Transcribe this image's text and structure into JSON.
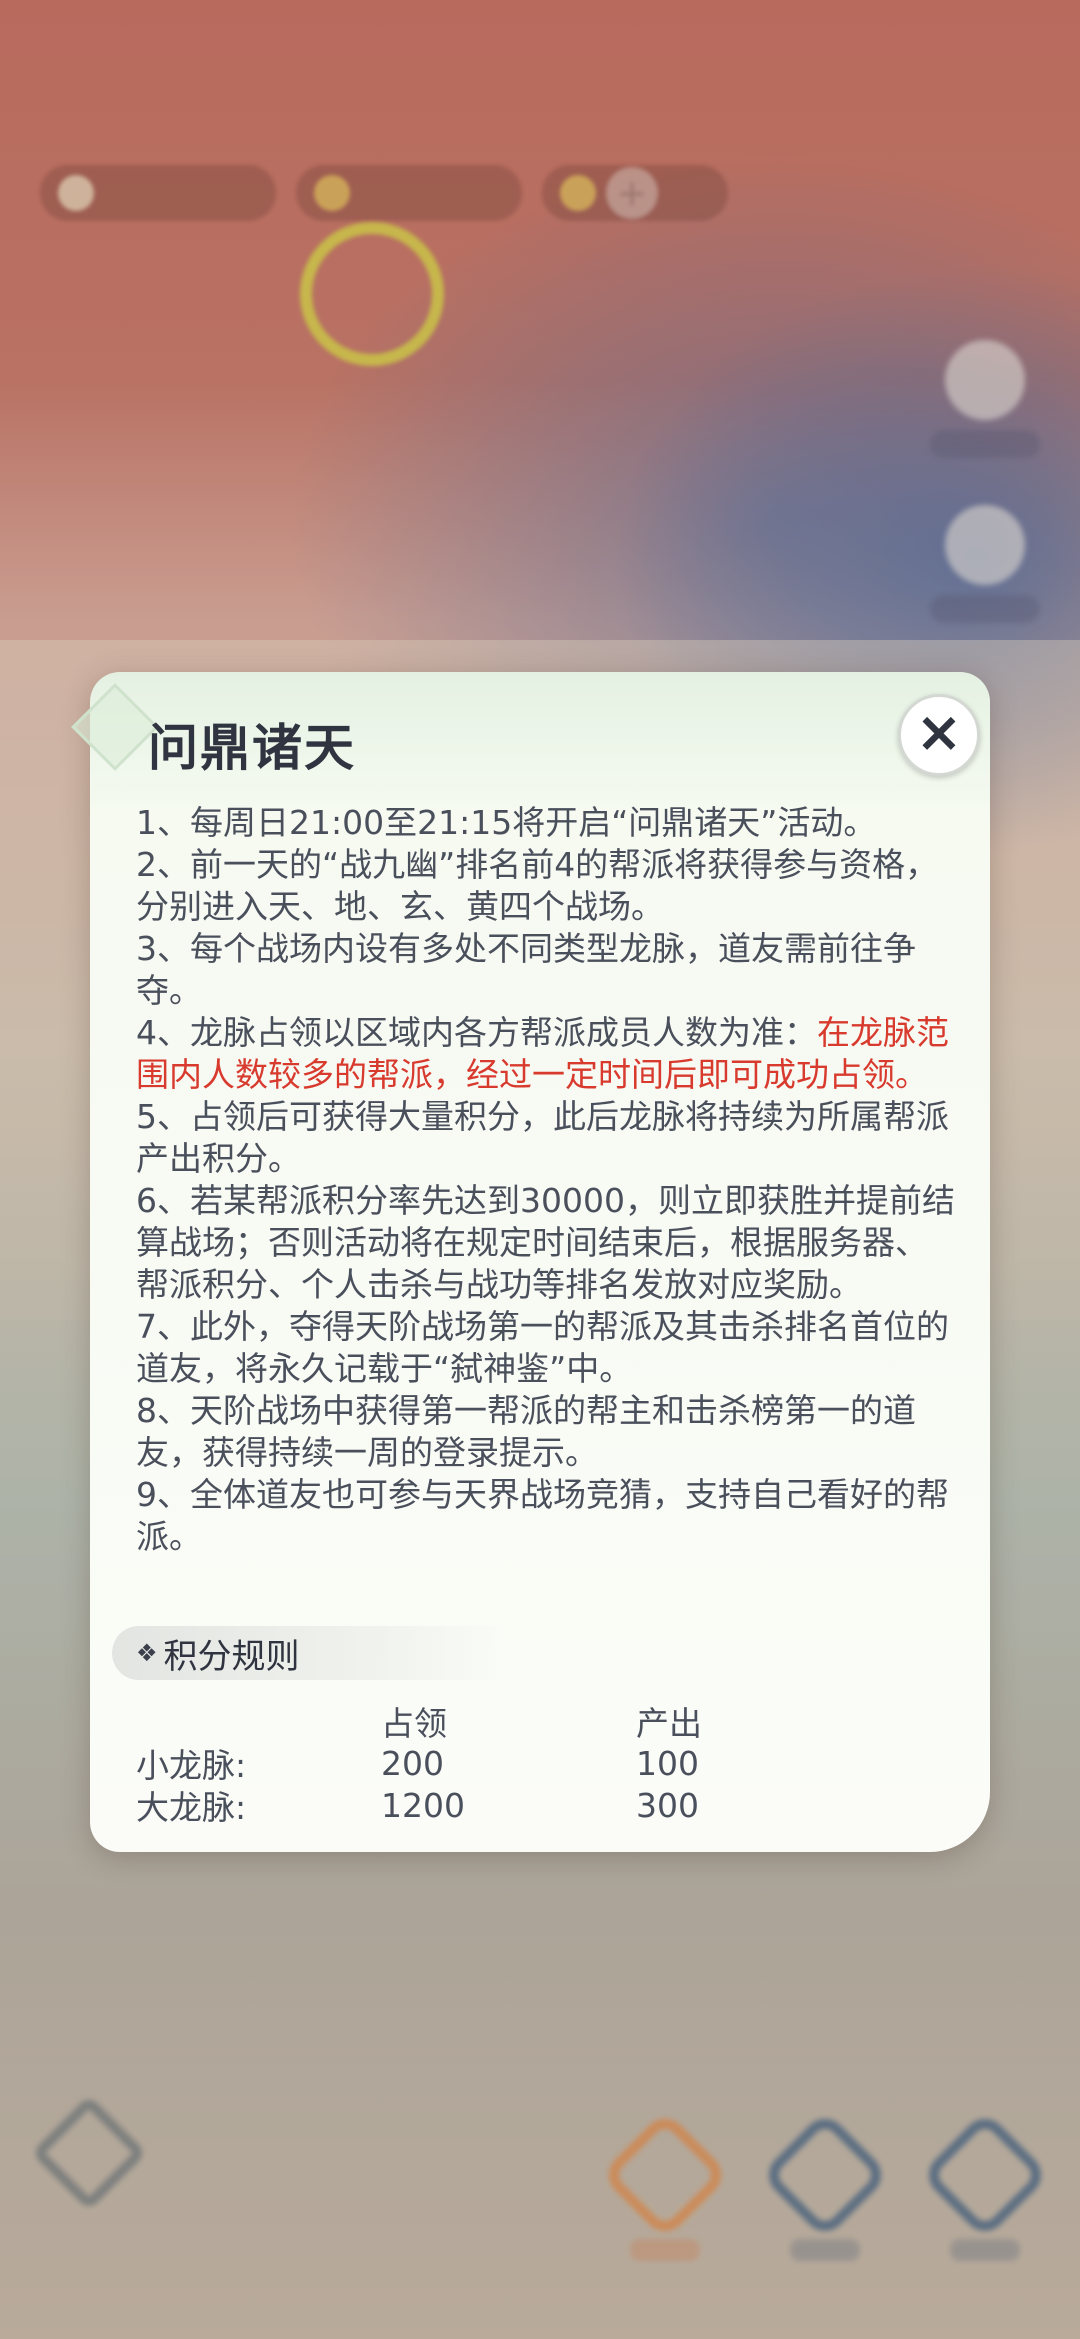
{
  "modal": {
    "title": "问鼎诸天",
    "close_icon": "×",
    "rules": [
      {
        "text": "1、每周日21:00至21:15将开启“问鼎诸天”活动。",
        "highlight": ""
      },
      {
        "text": "2、前一天的“战九幽”排名前4的帮派将获得参与资格，分别进入天、地、玄、黄四个战场。",
        "highlight": ""
      },
      {
        "text": "3、每个战场内设有多处不同类型龙脉，道友需前往争夺。",
        "highlight": ""
      },
      {
        "text": "4、龙脉占领以区域内各方帮派成员人数为准：",
        "highlight": "在龙脉范围内人数较多的帮派，经过一定时间后即可成功占领。"
      },
      {
        "text": "5、占领后可获得大量积分，此后龙脉将持续为所属帮派产出积分。",
        "highlight": ""
      },
      {
        "text": "6、若某帮派积分率先达到30000，则立即获胜并提前结算战场；否则活动将在规定时间结束后，根据服务器、帮派积分、个人击杀与战功等排名发放对应奖励。",
        "highlight": ""
      },
      {
        "text": "7、此外，夺得天阶战场第一的帮派及其击杀排名首位的道友，将永久记载于“弑神鉴”中。",
        "highlight": ""
      },
      {
        "text": "8、天阶战场中获得第一帮派的帮主和击杀榜第一的道友，获得持续一周的登录提示。",
        "highlight": ""
      },
      {
        "text": "9、全体道友也可参与天界战场竞猜，支持自己看好的帮派。",
        "highlight": ""
      }
    ],
    "score_section": {
      "icon": "❖",
      "title": "积分规则",
      "headers": [
        "",
        "占领",
        "产出"
      ],
      "rows": [
        [
          "小龙脉:",
          "200",
          "100"
        ],
        [
          "大龙脉:",
          "1200",
          "300"
        ]
      ]
    }
  },
  "colors": {
    "highlight_red": "#d83a2e",
    "text_primary": "#4a4f5c",
    "title_dark": "#2f3440"
  }
}
